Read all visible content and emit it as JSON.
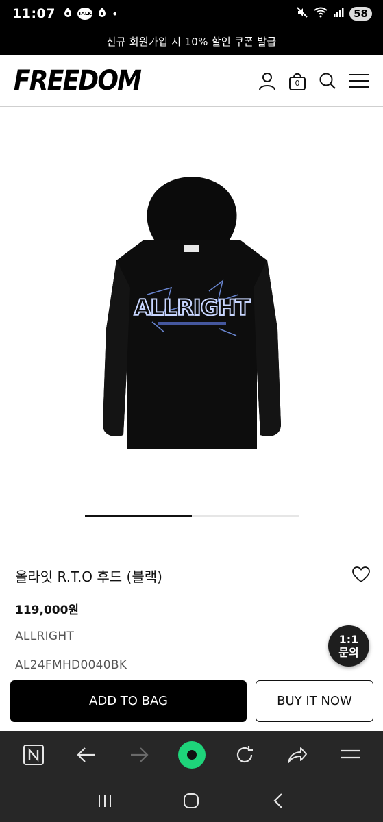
{
  "status": {
    "time": "11:07",
    "left_icons": [
      "ring-notification-icon",
      "kakaotalk-icon",
      "ring-notification-icon",
      "dot-icon"
    ],
    "talk_label": "TALK",
    "dot": "•",
    "right_icons": [
      "mute-icon",
      "wifi-icon",
      "signal-icon"
    ],
    "battery": "58"
  },
  "promo": {
    "text": "신규 회원가입 시 10% 할인 쿠폰 발급"
  },
  "header": {
    "logo": "FREEDOM",
    "bag_count": "0",
    "icons": [
      "user-icon",
      "bag-icon",
      "search-icon",
      "menu-icon"
    ]
  },
  "gallery": {
    "slide_progress": 0.5,
    "print_text": "ALLRIGHT"
  },
  "product": {
    "title": "올라잇 R.T.O 후드 (블랙)",
    "price": "119,000원",
    "brand": "ALLRIGHT",
    "code": "AL24FMHD0040BK"
  },
  "inquiry": {
    "line1": "1:1",
    "line2": "문의"
  },
  "actions": {
    "add_to_bag": "ADD TO BAG",
    "buy_now": "BUY IT NOW"
  },
  "browser_toolbar": {
    "items": [
      "naver-home-icon",
      "back-arrow-icon",
      "forward-arrow-icon",
      "green-dot-icon",
      "refresh-icon",
      "share-icon",
      "menu-icon"
    ],
    "accent": "#1ed47a"
  },
  "navigation": {
    "items": [
      "recent-apps-icon",
      "home-icon",
      "back-icon"
    ]
  }
}
